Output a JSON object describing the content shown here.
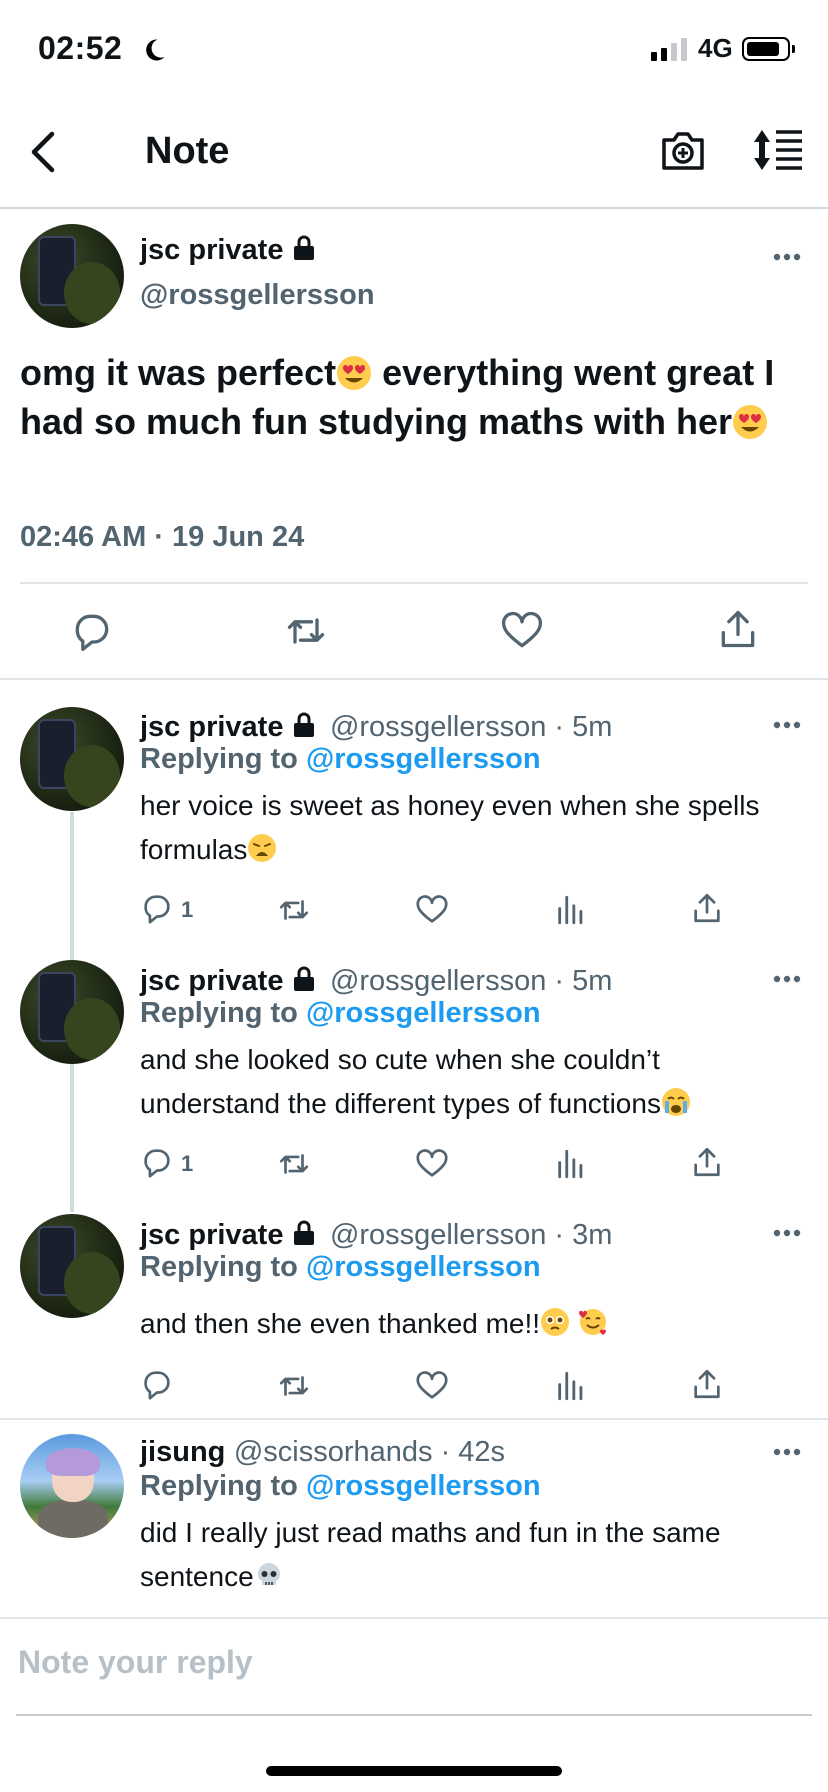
{
  "status_bar": {
    "time": "02:52",
    "network": "4G"
  },
  "nav": {
    "title": "Note"
  },
  "main_tweet": {
    "name": "jsc private",
    "handle": "@rossgellersson",
    "text_1": "omg it was perfect",
    "text_2": "everything went great I had so much fun studying maths with her",
    "timestamp": "02:46 AM · 19 Jun 24"
  },
  "replies": [
    {
      "name": "jsc private",
      "handle_time": "@rossgellersson · 5m",
      "replying_prefix": "Replying to",
      "replying_handle": "@rossgellersson",
      "text": "her voice is sweet as honey even when she spells formulas",
      "reply_count": "1"
    },
    {
      "name": "jsc private",
      "handle_time": "@rossgellersson · 5m",
      "replying_prefix": "Replying to",
      "replying_handle": "@rossgellersson",
      "text": "and she looked so cute when she couldn’t understand the different types of functions",
      "reply_count": "1"
    },
    {
      "name": "jsc private",
      "handle_time": "@rossgellersson · 3m",
      "replying_prefix": "Replying to",
      "replying_handle": "@rossgellersson",
      "text": "and then she even thanked me!!",
      "reply_count": ""
    },
    {
      "name": "jisung",
      "handle_time": "@scissorhands · 42s",
      "replying_prefix": "Replying to",
      "replying_handle": "@rossgellersson",
      "text": "did I really just read maths and fun in the same sentence"
    }
  ],
  "compose": {
    "placeholder": "Note your reply"
  },
  "icons": {
    "moon": "moon-icon",
    "back": "chevron-left-icon",
    "camera": "camera-plus-icon",
    "sort": "sort-icon",
    "lock": "lock-icon",
    "more": "more-icon",
    "reply": "reply-icon",
    "retweet": "retweet-icon",
    "like": "heart-icon",
    "views": "views-icon",
    "share": "share-icon"
  },
  "colors": {
    "link": "#1d9bf0",
    "secondary": "#536471",
    "divider": "#e1e6ea"
  }
}
